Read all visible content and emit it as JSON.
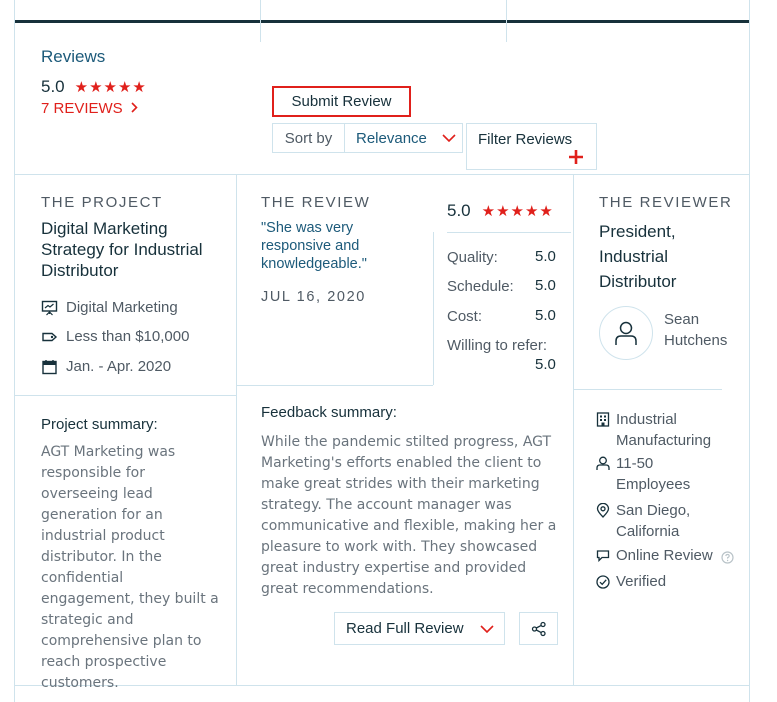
{
  "header": {
    "title": "Reviews",
    "rating": "5.0",
    "reviews_link": "7 REVIEWS",
    "submit_label": "Submit Review",
    "sort_label": "Sort by",
    "sort_value": "Relevance",
    "filter_label": "Filter Reviews"
  },
  "project": {
    "section": "THE PROJECT",
    "title": "Digital Marketing Strategy for Industrial Distributor",
    "service": "Digital Marketing",
    "budget": "Less than $10,000",
    "dates": "Jan. - Apr. 2020",
    "summary_label": "Project summary:",
    "summary": "AGT Marketing was responsible for overseeing lead generation for an industrial product distributor. In the confidential engagement, they built a strategic and comprehensive plan to reach prospective customers."
  },
  "review": {
    "section": "THE REVIEW",
    "quote": "\"She was very responsive and knowledgeable.\"",
    "date": "JUL 16, 2020",
    "overall": "5.0",
    "scores": [
      {
        "label": "Quality:",
        "value": "5.0"
      },
      {
        "label": "Schedule:",
        "value": "5.0"
      },
      {
        "label": "Cost:",
        "value": "5.0"
      },
      {
        "label": "Willing to refer:",
        "value": "5.0"
      }
    ],
    "feedback_label": "Feedback summary:",
    "feedback": "While the pandemic stilted progress, AGT Marketing's efforts enabled the client to make great strides with their marketing strategy. The account manager was communicative and flexible, making her a pleasure to work with. They showcased great industry expertise and provided great recommendations.",
    "read_full_label": "Read Full Review"
  },
  "reviewer": {
    "section": "THE REVIEWER",
    "title": "President, Industrial Distributor",
    "name": "Sean Hutchens",
    "industry": "Industrial Manufacturing",
    "employees": "11-50 Employees",
    "location": "San Diego, California",
    "review_type": "Online Review",
    "status": "Verified"
  },
  "colors": {
    "accent_red": "#e0201b",
    "link_blue": "#1c5a7a",
    "border": "#cfe3ec",
    "dark": "#17313b"
  }
}
